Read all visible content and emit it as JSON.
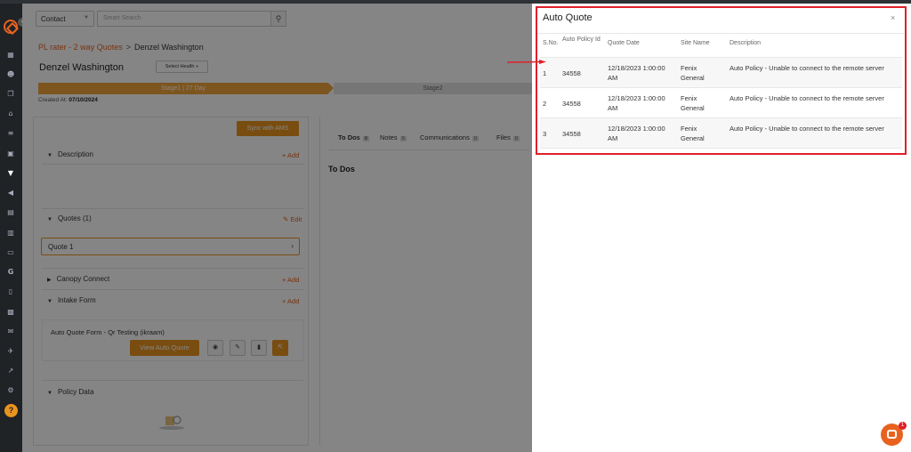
{
  "topbar": {
    "entity_select": "Contact",
    "search_placeholder": "Smart Search"
  },
  "breadcrumb": {
    "parent": "PL rater - 2 way Quotes",
    "separator": ">",
    "current": "Denzel Washington"
  },
  "contact": {
    "name": "Denzel Washington",
    "health_button": "Select Health +",
    "created_label": "Created At:",
    "created_value": "07/10/2024"
  },
  "stages": {
    "stage1": "Stage1 | 27 Day",
    "stage2": "Stage2"
  },
  "left_panel": {
    "sync_button": "Sync with AMS",
    "description_label": "Description",
    "add_label": "+ Add",
    "quotes_label": "Quotes (1)",
    "edit_label": "✎ Edit",
    "quote_item": "Quote 1",
    "canopy_label": "Canopy Connect",
    "intake_label": "Intake Form",
    "intake_form_title": "Auto Quote Form - Qr Testing (ikraam)",
    "view_button": "View Auto Quote",
    "policy_label": "Policy Data"
  },
  "right_panel": {
    "tabs": [
      {
        "label": "To Dos",
        "count": "0"
      },
      {
        "label": "Notes",
        "count": "0"
      },
      {
        "label": "Communications",
        "count": "0"
      },
      {
        "label": "Files",
        "count": "0"
      }
    ],
    "todos_heading": "To Dos"
  },
  "modal": {
    "title": "Auto Quote",
    "close": "×",
    "columns": [
      "S.No.",
      "Auto Policy Id",
      "Quote Date",
      "Site Name",
      "Description"
    ],
    "rows": [
      {
        "sno": "1",
        "policy_id": "34558",
        "date": "12/18/2023 1:00:00 AM",
        "site": "Fenix General",
        "description": "Auto Policy - Unable to connect to the remote server"
      },
      {
        "sno": "2",
        "policy_id": "34558",
        "date": "12/18/2023 1:00:00 AM",
        "site": "Fenix General",
        "description": "Auto Policy - Unable to connect to the remote server"
      },
      {
        "sno": "3",
        "policy_id": "34558",
        "date": "12/18/2023 1:00:00 AM",
        "site": "Fenix General",
        "description": "Auto Policy - Unable to connect to the remote server"
      }
    ]
  },
  "chat": {
    "badge": "1"
  },
  "colors": {
    "accent_orange": "#e8941f",
    "brand_orange": "#e8621f",
    "highlight_red": "#e0202a",
    "sidebar": "#1f2326"
  },
  "sidebar_icons": [
    "dashboard-icon",
    "users-icon",
    "copy-icon",
    "bank-icon",
    "list-icon",
    "image-icon",
    "filter-icon",
    "megaphone-icon",
    "document-icon",
    "chart-icon",
    "folder-icon",
    "google-icon",
    "file-icon",
    "calendar-icon",
    "mail-icon",
    "plane-icon",
    "trend-icon",
    "gear-icon",
    "help-icon"
  ]
}
